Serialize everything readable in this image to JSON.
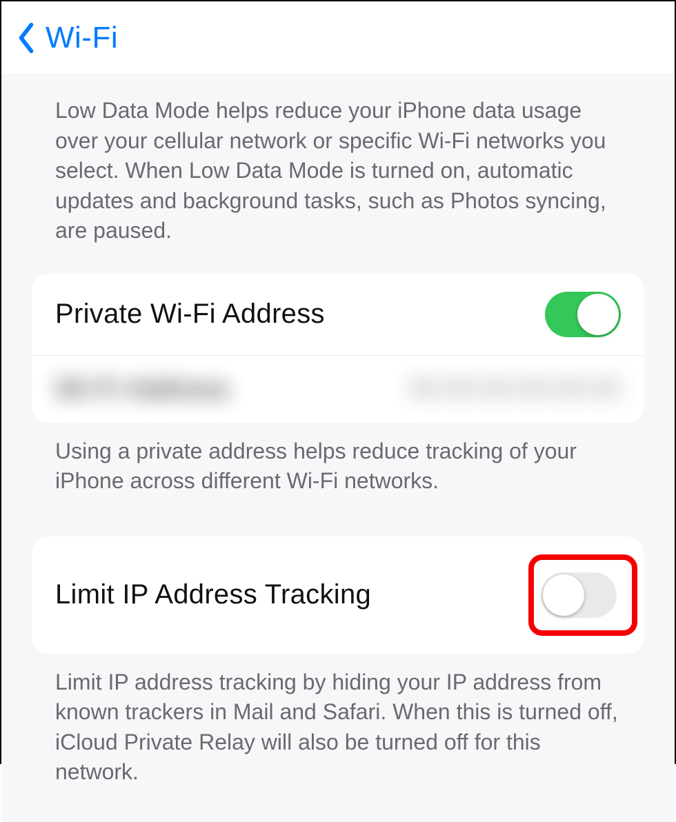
{
  "header": {
    "back_label": "Wi-Fi"
  },
  "low_data_mode_desc": "Low Data Mode helps reduce your iPhone data usage over your cellular network or specific Wi-Fi networks you select. When Low Data Mode is turned on, automatic updates and background tasks, such as Photos syncing, are paused.",
  "private_wifi": {
    "label": "Private Wi-Fi Address",
    "on": true
  },
  "wifi_address": {
    "label": "Wi-Fi Address",
    "value": "00:00:00:00:00:00"
  },
  "private_wifi_desc": "Using a private address helps reduce tracking of your iPhone across different Wi-Fi networks.",
  "limit_ip": {
    "label": "Limit IP Address Tracking",
    "on": false
  },
  "limit_ip_desc": "Limit IP address tracking by hiding your IP address from known trackers in Mail and Safari. When this is turned off, iCloud Private Relay will also be turned off for this network."
}
